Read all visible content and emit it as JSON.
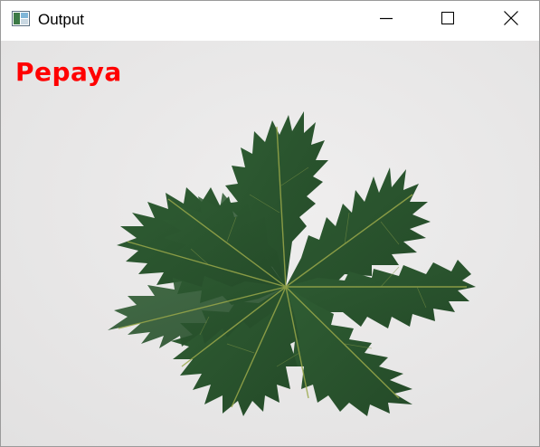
{
  "window": {
    "title": "Output",
    "app_icon": "opencv-window-icon"
  },
  "controls": {
    "minimize_icon": "minimize-icon",
    "maximize_icon": "maximize-icon",
    "close_icon": "close-icon"
  },
  "image": {
    "label": "Pepaya",
    "label_color": "#ff0000",
    "leaf_color": "#2e5a30",
    "background_color": "#e9e8e8"
  }
}
